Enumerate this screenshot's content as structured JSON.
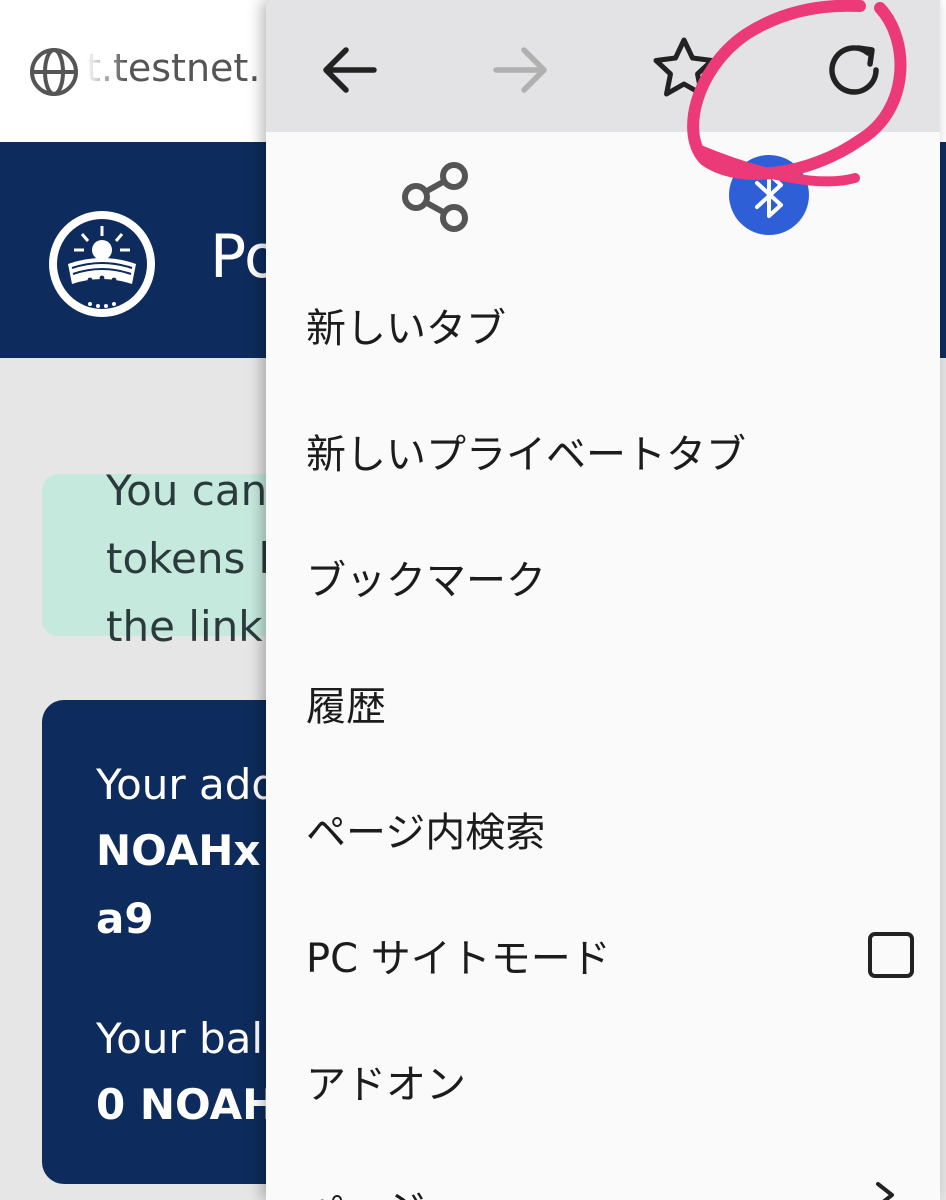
{
  "browser": {
    "url_visible": "t.testnet."
  },
  "page": {
    "site_title": "Po",
    "info_lines": [
      "You can",
      "tokens b",
      "the link"
    ],
    "wallet": {
      "address_label": "Your add",
      "address_value_line1": "NOAHx",
      "address_value_line2": "a9",
      "balance_label": "Your bal",
      "balance_value": "0 NOAH"
    }
  },
  "menu": {
    "items": [
      {
        "label": "新しいタブ"
      },
      {
        "label": "新しいプライベートタブ"
      },
      {
        "label": "ブックマーク"
      },
      {
        "label": "履歴"
      },
      {
        "label": "ページ内検索"
      },
      {
        "label": "PC サイトモード"
      },
      {
        "label": "アドオン"
      },
      {
        "label": "ページ"
      }
    ]
  },
  "icons": {
    "toolbar": [
      "back-arrow-icon",
      "forward-arrow-icon",
      "bookmark-star-icon",
      "reload-icon"
    ],
    "row2": [
      "share-icon",
      "bluetooth-icon"
    ]
  },
  "colors": {
    "menu_background": "#fafafa",
    "toolbar_background": "#e3e3e6",
    "site_header": "#0d2b5c",
    "info_box": "#c6e9de",
    "annotation": "#ec3a78",
    "bluetooth": "#2f5fd6"
  }
}
